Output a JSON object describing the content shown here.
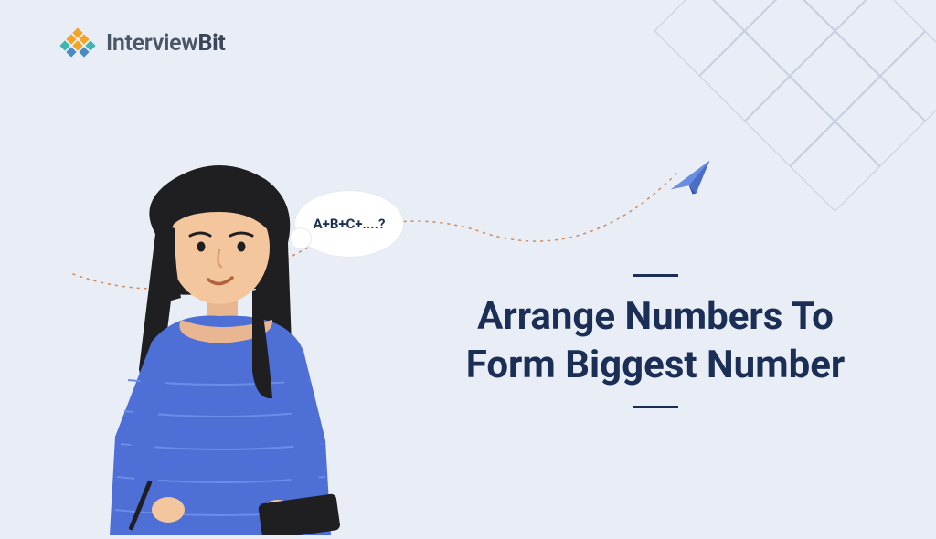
{
  "brand": {
    "name_prefix": "Interview",
    "name_suffix": "Bit"
  },
  "bubble": {
    "text": "A+B+C+....?"
  },
  "title": {
    "text": "Arrange Numbers To Form Biggest Number"
  },
  "colors": {
    "bg": "#e8edf6",
    "ink": "#1b2f56",
    "plane": "#4a6dc9",
    "diamond": "#a9b4c9",
    "logo_orange": "#f4a423",
    "logo_teal": "#3fb6b2",
    "logo_blue": "#4a8bc2"
  }
}
